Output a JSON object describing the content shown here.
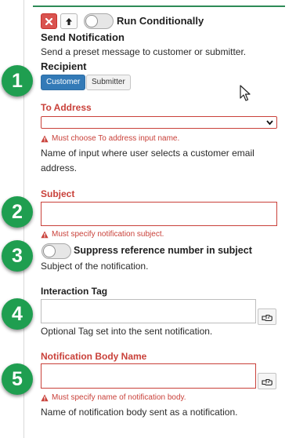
{
  "toolbar": {
    "delete_icon": "x-icon",
    "move_up_icon": "arrow-up-icon",
    "run_conditionally_label": "Run Conditionally"
  },
  "action": {
    "title": "Send Notification",
    "description": "Send a preset message to customer or submitter."
  },
  "recipient": {
    "label": "Recipient",
    "options": [
      "Customer",
      "Submitter"
    ],
    "selected": "Customer"
  },
  "to_address": {
    "label": "To Address",
    "value": "",
    "error": "Must choose To address input name.",
    "help_line1": "Name of input where user selects a customer email",
    "help_line2": "address."
  },
  "subject": {
    "label": "Subject",
    "value": "",
    "error": "Must specify notification subject.",
    "suppress_label": "Suppress reference number in subject",
    "help": "Subject of the notification."
  },
  "interaction_tag": {
    "label": "Interaction Tag",
    "value": "",
    "help": "Optional Tag set into the sent notification."
  },
  "body_name": {
    "label": "Notification Body Name",
    "value": "",
    "error": "Must specify name of notification body.",
    "help": "Name of notification body sent as a notification."
  },
  "badges": [
    "1",
    "2",
    "3",
    "4",
    "5"
  ],
  "colors": {
    "accent_green": "#2e8b57",
    "badge_green": "#1f9e50",
    "error_red": "#c9413a",
    "primary_blue": "#337ab7",
    "danger_red": "#d9534f"
  }
}
